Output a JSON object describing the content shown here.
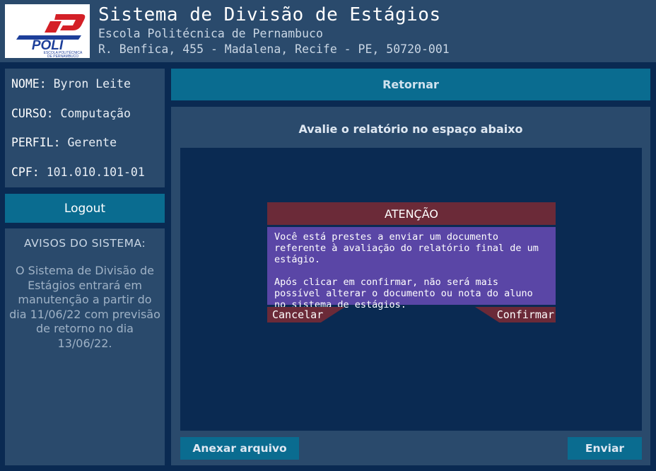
{
  "header": {
    "logo_text": "POLI",
    "logo_caption": "ESCOLA POLITÉCNICA DE PERNAMBUCO",
    "title": "Sistema de Divisão de Estágios",
    "subtitle": "Escola Politécnica de Pernambuco",
    "address": "R. Benfica, 455 - Madalena, Recife - PE, 50720-001"
  },
  "user": {
    "nome_label": "NOME:",
    "nome": "Byron Leite",
    "curso_label": "CURSO:",
    "curso": "Computação",
    "perfil_label": "PERFIL:",
    "perfil": "Gerente",
    "cpf_label": "CPF:",
    "cpf": "101.010.101-01"
  },
  "sidebar": {
    "logout_label": "Logout",
    "avisos_title": "AVISOS DO SISTEMA:",
    "avisos_text": "O Sistema de Divisão de Estágios entrará em manutenção a partir do dia 11/06/22 com previsão de retorno no dia 13/06/22."
  },
  "main": {
    "retornar_label": "Retornar",
    "title": "Avalie o relatório no espaço abaixo",
    "anexar_label": "Anexar arquivo",
    "enviar_label": "Enviar"
  },
  "modal": {
    "title": "ATENÇÃO",
    "paragraph1": "Você está prestes a enviar um documento referente à avaliação do relatório final de um estágio.",
    "paragraph2": "Após clicar em confirmar, não será mais possível alterar o documento ou nota do aluno no sistema de estágios.",
    "cancel_label": "Cancelar",
    "confirm_label": "Confirmar"
  },
  "colors": {
    "background": "#0a2a52",
    "panel": "#2a4a6c",
    "accent_button": "#0a6c90",
    "modal_header": "#6b2a38",
    "modal_body": "#5a46a6"
  }
}
